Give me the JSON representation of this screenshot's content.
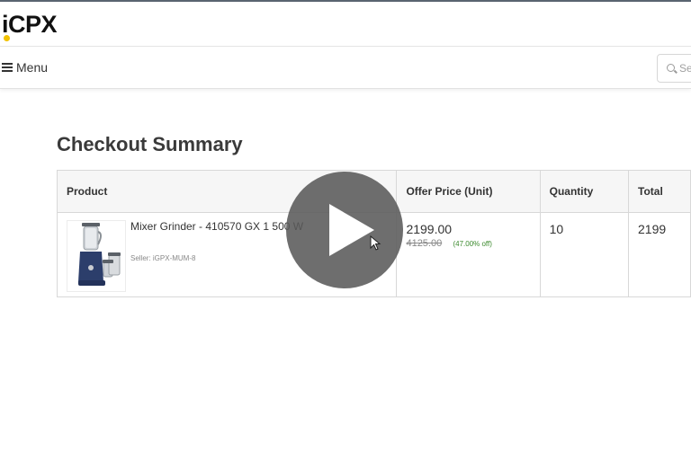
{
  "header": {
    "logo_text": "iCPX",
    "logo_dot_color": "#f2c200"
  },
  "nav": {
    "menu_label": "Menu",
    "search_placeholder": "Se"
  },
  "checkout": {
    "title": "Checkout Summary",
    "columns": [
      "Product",
      "Offer Price (Unit)",
      "Quantity",
      "Total"
    ],
    "items": [
      {
        "product_name": "Mixer Grinder - 410570 GX 1 500 W",
        "seller": "Seller: iGPX-MUM-8",
        "offer_price": "2199.00",
        "mrp": "4125.00",
        "discount": "(47.00% off)",
        "quantity": "10",
        "total": "2199"
      }
    ]
  },
  "video": {
    "play_icon": "play-icon"
  }
}
